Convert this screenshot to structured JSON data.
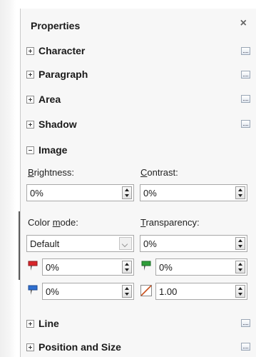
{
  "panel": {
    "title": "Properties",
    "close_glyph": "×"
  },
  "sections": {
    "character": "Character",
    "paragraph": "Paragraph",
    "area": "Area",
    "shadow": "Shadow",
    "image": "Image",
    "line": "Line",
    "position_size": "Position and Size"
  },
  "image": {
    "brightness": {
      "label_u": "B",
      "label_rest": "rightness:",
      "value": "0%"
    },
    "contrast": {
      "label_u": "C",
      "label_rest": "ontrast:",
      "value": "0%"
    },
    "color_mode": {
      "label_pre": "Color ",
      "label_u": "m",
      "label_rest": "ode:",
      "value": "Default"
    },
    "transparency": {
      "label_u": "T",
      "label_rest": "ransparency:",
      "value": "0%"
    },
    "red": {
      "value": "0%",
      "icon": "red-channel-icon"
    },
    "green": {
      "value": "0%",
      "icon": "green-channel-icon"
    },
    "blue": {
      "value": "0%",
      "icon": "blue-channel-icon"
    },
    "gamma": {
      "value": "1.00",
      "icon": "gamma-icon"
    }
  },
  "colors": {
    "red": "#d9262b",
    "green": "#2f9e3a",
    "blue": "#2f6fd0",
    "gamma": "#c9501c"
  }
}
